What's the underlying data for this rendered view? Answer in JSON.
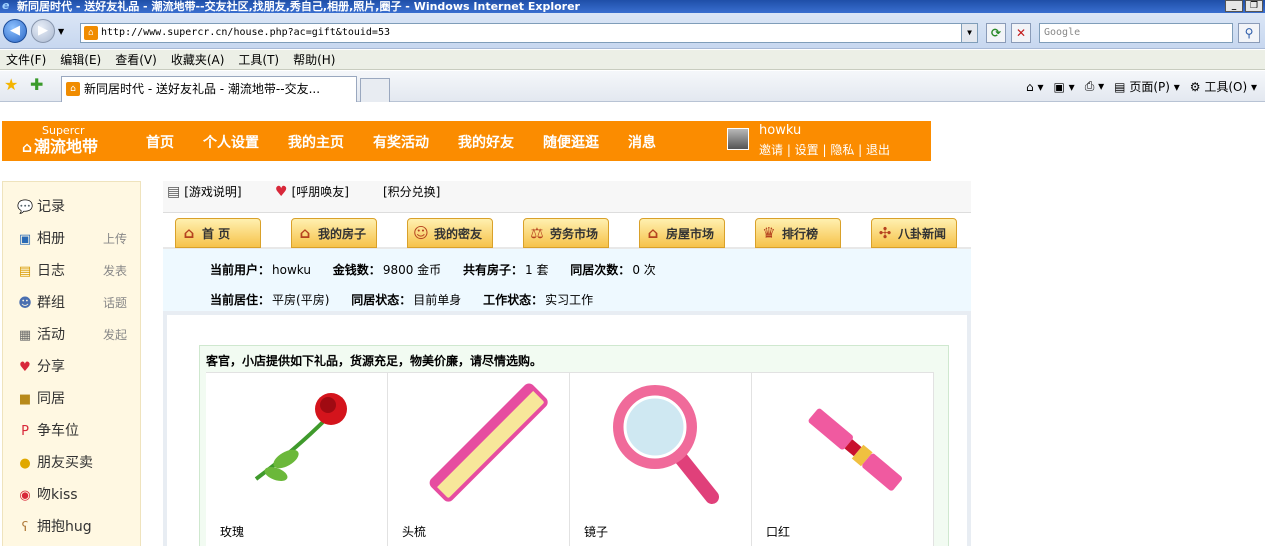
{
  "browser": {
    "window_title": "新同居时代 - 送好友礼品 - 潮流地带--交友社区,找朋友,秀自己,相册,照片,圈子 - Windows Internet Explorer",
    "url": "http://www.supercr.cn/house.php?ac=gift&touid=53",
    "search_placeholder": "Google",
    "menu": [
      "文件(F)",
      "编辑(E)",
      "查看(V)",
      "收藏夹(A)",
      "工具(T)",
      "帮助(H)"
    ],
    "tab_title": "新同居时代 - 送好友礼品 - 潮流地带--交友...",
    "commands": {
      "page": "页面(P)",
      "tools": "工具(O)"
    }
  },
  "site": {
    "logo_en": "Supercr",
    "logo_cn": "潮流地带",
    "nav": [
      "首页",
      "个人设置",
      "我的主页",
      "有奖活动",
      "我的好友",
      "随便逛逛",
      "消息"
    ],
    "user": {
      "name": "howku",
      "links": "邀请 | 设置 | 隐私 | 退出"
    }
  },
  "sidebar": {
    "items": [
      {
        "label": "记录",
        "sub": "",
        "icon": "speech-bubble-icon"
      },
      {
        "label": "相册",
        "sub": "上传",
        "icon": "photo-icon"
      },
      {
        "label": "日志",
        "sub": "发表",
        "icon": "notebook-icon"
      },
      {
        "label": "群组",
        "sub": "话题",
        "icon": "group-icon"
      },
      {
        "label": "活动",
        "sub": "发起",
        "icon": "calendar-icon"
      },
      {
        "label": "分享",
        "sub": "",
        "icon": "hearts-icon"
      },
      {
        "label": "同居",
        "sub": "",
        "icon": "house-icon"
      },
      {
        "label": "争车位",
        "sub": "",
        "icon": "parking-icon"
      },
      {
        "label": "朋友买卖",
        "sub": "",
        "icon": "coins-icon"
      },
      {
        "label": "吻kiss",
        "sub": "",
        "icon": "lips-icon"
      },
      {
        "label": "拥抱hug",
        "sub": "",
        "icon": "bear-icon"
      }
    ]
  },
  "game": {
    "links": [
      "[游戏说明]",
      "[呼朋唤友]",
      "[积分兑换]"
    ],
    "tabs": [
      "首 页",
      "我的房子",
      "我的密友",
      "劳务市场",
      "房屋市场",
      "排行榜",
      "八卦新闻"
    ],
    "info": {
      "row1": {
        "current_user_label": "当前用户：",
        "current_user": "howku",
        "money_label": "金钱数：",
        "money": "9800 金币",
        "houses_label": "共有房子：",
        "houses": "1 套",
        "cohabit_label": "同居次数：",
        "cohabit": "0 次"
      },
      "row2": {
        "residence_label": "当前居住：",
        "residence": "平房(平房)",
        "status_label": "同居状态：",
        "status": "目前单身",
        "work_label": "工作状态：",
        "work": "实习工作"
      }
    },
    "shop_intro": "客官，小店提供如下礼品，货源充足，物美价廉，请尽情选购。",
    "gifts": [
      {
        "name": "玫瑰",
        "icon": "rose-icon"
      },
      {
        "name": "头梳",
        "icon": "comb-icon"
      },
      {
        "name": "镜子",
        "icon": "mirror-icon"
      },
      {
        "name": "口红",
        "icon": "lipstick-icon"
      }
    ]
  }
}
